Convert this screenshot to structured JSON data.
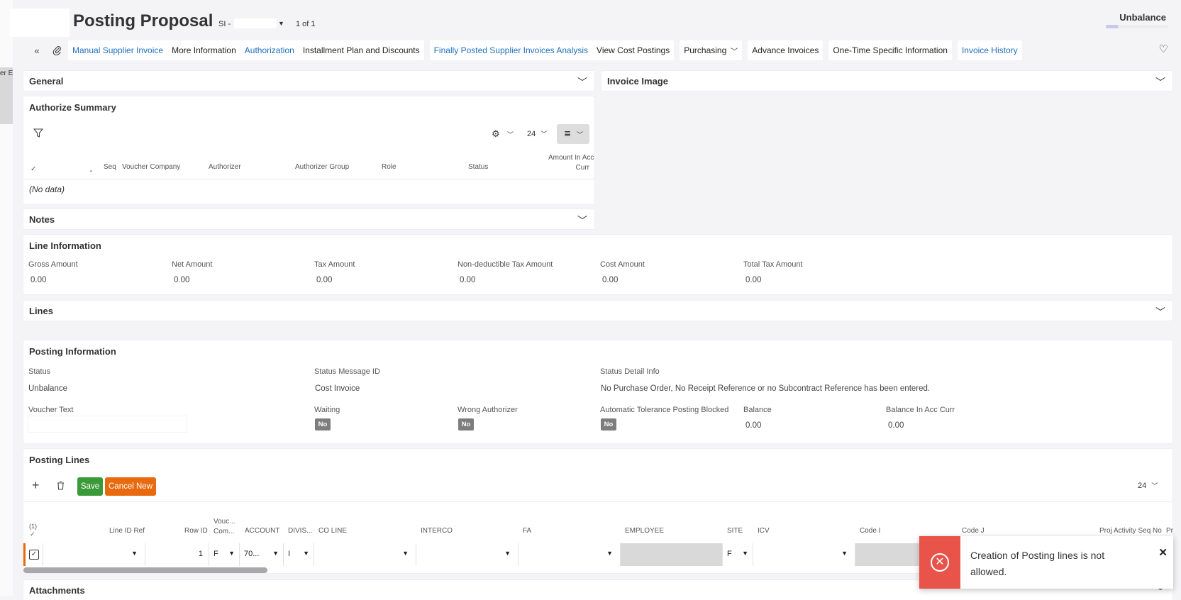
{
  "left_strip_text": "er E",
  "header": {
    "title": "Posting Proposal",
    "record_prefix": "SI -",
    "record_count": "1 of 1",
    "state": "Unbalance"
  },
  "commands": {
    "manual_supplier_invoice": "Manual Supplier Invoice",
    "more_information": "More Information",
    "authorization": "Authorization",
    "installment_plan": "Installment Plan and Discounts",
    "finally_posted": "Finally Posted Supplier Invoices Analysis",
    "view_cost_postings": "View Cost Postings",
    "purchasing": "Purchasing",
    "advance_invoices": "Advance Invoices",
    "one_time_info": "One-Time Specific Information",
    "invoice_history": "Invoice History"
  },
  "general": {
    "title": "General"
  },
  "invoice_image": {
    "title": "Invoice Image"
  },
  "authorize_summary": {
    "title": "Authorize Summary",
    "page_size": "24",
    "columns": {
      "seq": "Seq",
      "voucher_company": "Voucher Company",
      "authorizer": "Authorizer",
      "authorizer_group": "Authorizer Group",
      "role": "Role",
      "status": "Status",
      "amount_line1": "Amount In Acc",
      "amount_line2": "Curr"
    },
    "empty": "(No data)"
  },
  "notes": {
    "title": "Notes"
  },
  "line_information": {
    "title": "Line Information",
    "fields": [
      {
        "label": "Gross Amount",
        "value": "0.00"
      },
      {
        "label": "Net Amount",
        "value": "0.00"
      },
      {
        "label": "Tax Amount",
        "value": "0.00"
      },
      {
        "label": "Non-deductible Tax Amount",
        "value": "0.00"
      },
      {
        "label": "Cost Amount",
        "value": "0.00"
      },
      {
        "label": "Total Tax Amount",
        "value": "0.00"
      }
    ]
  },
  "lines": {
    "title": "Lines"
  },
  "posting_information": {
    "title": "Posting Information",
    "status_label": "Status",
    "status_value": "Unbalance",
    "status_msg_label": "Status Message ID",
    "status_msg_value": "Cost Invoice",
    "status_detail_label": "Status Detail Info",
    "status_detail_value": "No Purchase Order, No Receipt Reference or no Subcontract Reference has been entered.",
    "voucher_text_label": "Voucher Text",
    "waiting_label": "Waiting",
    "waiting_value": "No",
    "wrong_auth_label": "Wrong Authorizer",
    "wrong_auth_value": "No",
    "auto_tol_label": "Automatic Tolerance Posting Blocked",
    "auto_tol_value": "No",
    "balance_label": "Balance",
    "balance_value": "0.00",
    "balance_acc_label": "Balance In Acc Curr",
    "balance_acc_value": "0.00"
  },
  "posting_lines": {
    "title": "Posting Lines",
    "save": "Save",
    "cancel_new": "Cancel New",
    "page_size": "24",
    "selected_count": "(1)",
    "columns": {
      "line_id_ref": "Line ID Ref",
      "row_id": "Row ID",
      "vouc_com_1": "Vouc...",
      "vouc_com_2": "Com...",
      "account": "ACCOUNT",
      "division": "DIVIS...",
      "co_line": "CO LINE",
      "interco": "INTERCO",
      "fa": "FA",
      "employee": "EMPLOYEE",
      "site": "SITE",
      "icv": "ICV",
      "code_i": "Code I",
      "code_j": "Code J",
      "proj_activity": "Proj Activity Seq No",
      "pr": "Pr"
    },
    "row": {
      "row_id": "1",
      "voucher_company": "F",
      "account": "70...",
      "division": "I",
      "site": "F"
    }
  },
  "attachments": {
    "title": "Attachments"
  },
  "toast": {
    "message": "Creation of Posting lines is not allowed."
  }
}
